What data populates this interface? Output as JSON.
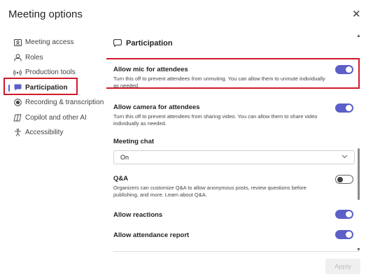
{
  "dialog": {
    "title": "Meeting options",
    "close_glyph": "✕"
  },
  "sidebar": {
    "items": [
      {
        "label": "Meeting access",
        "icon": "id-card-icon"
      },
      {
        "label": "Roles",
        "icon": "person-icon"
      },
      {
        "label": "Production tools",
        "icon": "broadcast-icon"
      },
      {
        "label": "Participation",
        "icon": "chat-bubble-icon",
        "active": true
      },
      {
        "label": "Recording & transcription",
        "icon": "record-icon"
      },
      {
        "label": "Copilot and other AI",
        "icon": "copilot-icon"
      },
      {
        "label": "Accessibility",
        "icon": "accessibility-icon"
      }
    ]
  },
  "content": {
    "section_title": "Participation",
    "section_icon": "chat-bubble-icon",
    "settings": {
      "mic": {
        "label": "Allow mic for attendees",
        "desc": "Turn this off to prevent attendees from unmuting. You can allow them to unmute individually as needed.",
        "enabled": true
      },
      "camera": {
        "label": "Allow camera for attendees",
        "desc": "Turn this off to prevent attendees from sharing video. You can allow them to share video individually as needed.",
        "enabled": true
      },
      "chat": {
        "label": "Meeting chat",
        "value": "On"
      },
      "qa": {
        "label": "Q&A",
        "desc": "Organizers can customize Q&A to allow anonymous posts, review questions before publishing, and more. Learn about Q&A.",
        "enabled": false
      },
      "reactions": {
        "label": "Allow reactions",
        "enabled": true
      },
      "attendance": {
        "label": "Allow attendance report",
        "enabled": true
      }
    }
  },
  "footer": {
    "apply_label": "Apply"
  },
  "colors": {
    "accent": "#5b5fc7",
    "highlight": "#d11a2a"
  }
}
